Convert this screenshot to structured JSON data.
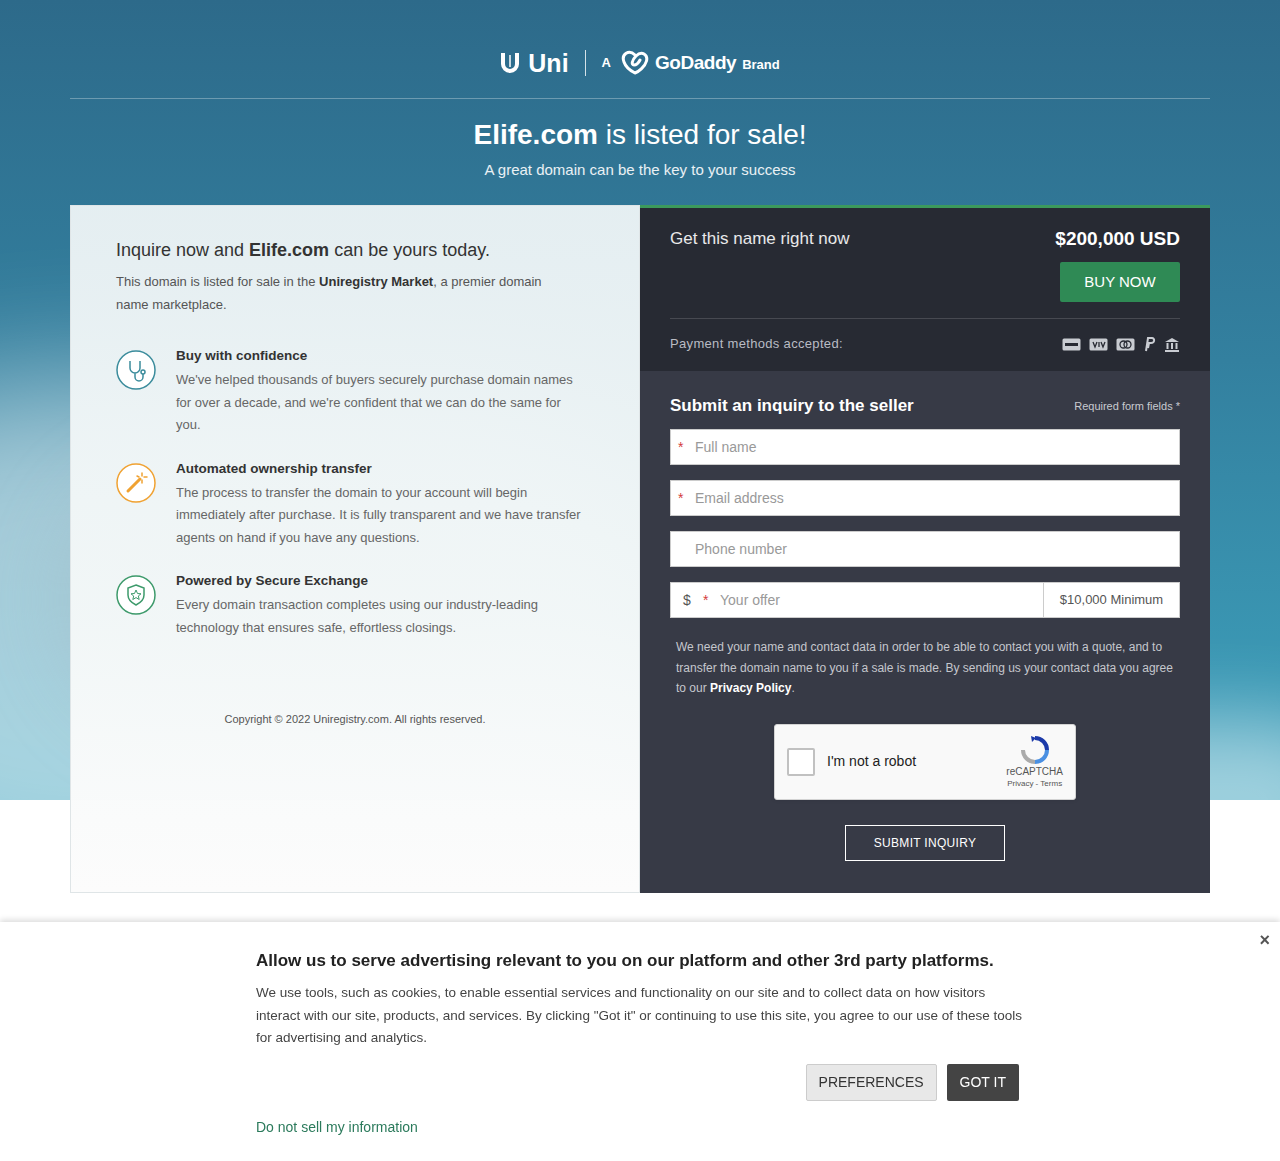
{
  "header": {
    "brand": "Uni",
    "tagline_prefix": "A",
    "partner": "GoDaddy",
    "partner_suffix": "Brand"
  },
  "hero": {
    "domain": "Elife.com",
    "title_rest": " is listed for sale!",
    "subtitle": "A great domain can be the key to your success"
  },
  "info": {
    "heading_prefix": "Inquire now and ",
    "heading_domain": "Elife.com",
    "heading_suffix": " can be yours today.",
    "intro_prefix": "This domain is listed for sale in the ",
    "intro_market": "Uniregistry Market",
    "intro_suffix": ", a premier domain name marketplace.",
    "features": [
      {
        "title": "Buy with confidence",
        "text": "We've helped thousands of buyers securely purchase domain names for over a decade, and we're confident that we can do the same for you."
      },
      {
        "title": "Automated ownership transfer",
        "text": "The process to transfer the domain to your account will begin immediately after purchase. It is fully transparent and we have transfer agents on hand if you have any questions."
      },
      {
        "title": "Powered by Secure Exchange",
        "text": "Every domain transaction completes using our industry-leading technology that ensures safe, effortless closings."
      }
    ],
    "copyright": "Copyright © 2022 Uniregistry.com. All rights reserved."
  },
  "purchase": {
    "label": "Get this name right now",
    "price": "$200,000 USD",
    "buy_button": "BUY NOW",
    "payment_label": "Payment methods accepted:"
  },
  "form": {
    "title": "Submit an inquiry to the seller",
    "required_note": "Required form fields *",
    "required_mark": "*",
    "fields": [
      {
        "placeholder": "Full name",
        "required": true
      },
      {
        "placeholder": "Email address",
        "required": true
      },
      {
        "placeholder": "Phone number",
        "required": false
      }
    ],
    "offer": {
      "currency": "$",
      "placeholder": "Your offer",
      "required": true,
      "minimum": "$10,000 Minimum"
    },
    "disclaimer_prefix": "We need your name and contact data in order to be able to contact you with a quote, and to transfer the domain name to you if a sale is made. By sending us your contact data you agree to our ",
    "privacy_link": "Privacy Policy",
    "disclaimer_suffix": ".",
    "captcha": {
      "label": "I'm not a robot",
      "checked": false,
      "brand": "reCAPTCHA",
      "privacy": "Privacy",
      "separator": " - ",
      "terms": "Terms"
    },
    "submit": "SUBMIT INQUIRY"
  },
  "cookie_banner": {
    "title": "Allow us to serve advertising relevant to you on our platform and other 3rd party platforms.",
    "text": "We use tools, such as cookies, to enable essential services and functionality on our site and to collect data on how visitors interact with our site, products, and services. By clicking \"Got it\" or continuing to use this site, you agree to our use of these tools for advertising and analytics.",
    "buttons": [
      "PREFERENCES",
      "GOT IT"
    ],
    "close": "×",
    "link": "Do not sell my information"
  }
}
